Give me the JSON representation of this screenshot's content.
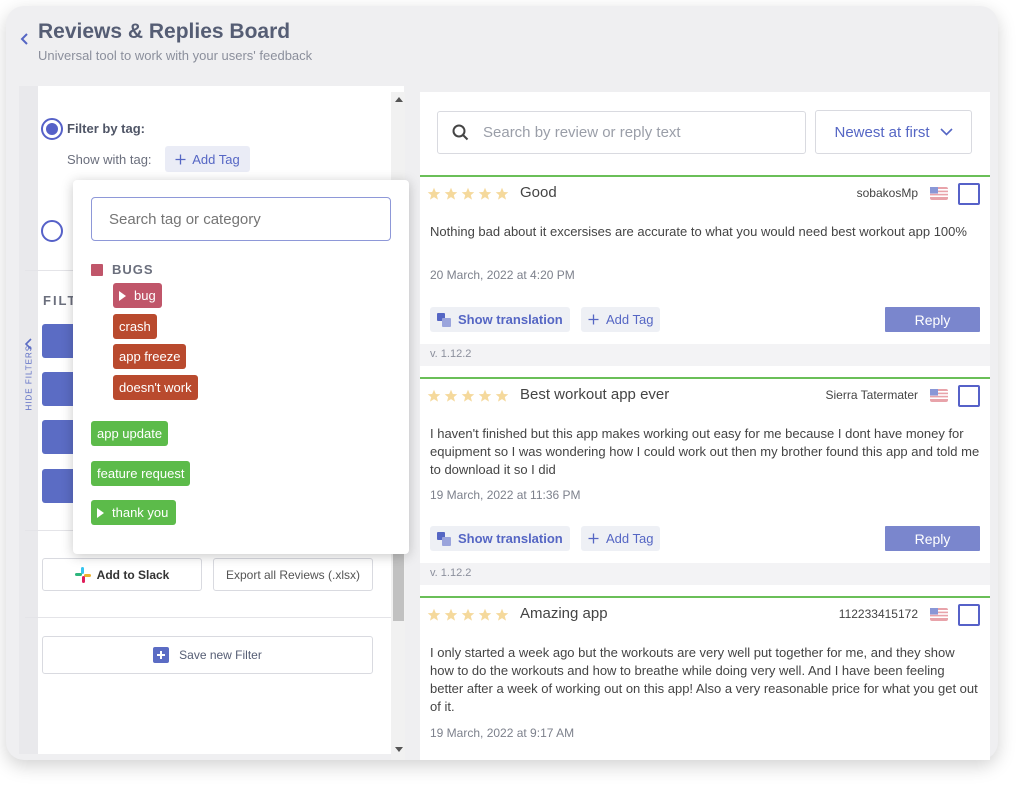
{
  "header": {
    "title": "Reviews & Replies Board",
    "subtitle": "Universal tool to work with your users' feedback"
  },
  "sidebar": {
    "hide_filters_label": "HIDE FILTERS",
    "filter_by_tag_label": "Filter by tag:",
    "show_with_tag_label": "Show with tag:",
    "add_tag_label": "Add Tag",
    "filters_heading": "FILT",
    "add_to_slack_label": "Add to Slack",
    "export_label": "Export all Reviews (.xlsx)",
    "save_filter_label": "Save new Filter"
  },
  "tag_dropdown": {
    "search_placeholder": "Search tag or category",
    "category": {
      "name": "BUGS",
      "color": "#c0566a"
    },
    "category_tags": [
      {
        "label": "bug",
        "color": "#c0566a",
        "has_children": true
      },
      {
        "label": "crash",
        "color": "#b94a2e",
        "has_children": false
      },
      {
        "label": "app freeze",
        "color": "#b94a2e",
        "has_children": false
      },
      {
        "label": "doesn't work",
        "color": "#b94a2e",
        "has_children": false
      }
    ],
    "other_tags": [
      {
        "label": "app update",
        "color": "#5cbb4a",
        "has_children": false
      },
      {
        "label": "feature request",
        "color": "#5cbb4a",
        "has_children": false
      },
      {
        "label": "thank you",
        "color": "#5cbb4a",
        "has_children": true
      }
    ]
  },
  "main": {
    "search_placeholder": "Search by review or reply text",
    "sort_label": "Newest at first",
    "accent_color": "#5566c4",
    "show_translation_label": "Show translation",
    "add_tag_label": "Add Tag",
    "reply_label": "Reply",
    "reviews": [
      {
        "rating": 5,
        "title": "Good",
        "author": "sobakosMp",
        "country_icon": "us-flag-icon",
        "text": "Nothing bad about it excersises are accurate to what you would need best workout app 100%",
        "date": "20 March, 2022 at 4:20 PM",
        "version": "v. 1.12.2"
      },
      {
        "rating": 5,
        "title": "Best workout app ever",
        "author": "Sierra Tatermater",
        "country_icon": "us-flag-icon",
        "text": "I haven't finished but this app makes working out easy for me because I dont have money for equipment so I was wondering how I could work out then my brother found this app and told me to download it so I did",
        "date": "19 March, 2022 at 11:36 PM",
        "version": "v. 1.12.2"
      },
      {
        "rating": 5,
        "title": "Amazing app",
        "author": "112233415172",
        "country_icon": "us-flag-icon",
        "text": "I only started a week ago but the workouts are very well put together for me, and they show how to do the workouts and how to breathe while doing very well. And I have been feeling better after a week of working out on this app! Also a very reasonable price for what you get out of it.",
        "date": "19 March, 2022 at 9:17 AM"
      }
    ]
  }
}
